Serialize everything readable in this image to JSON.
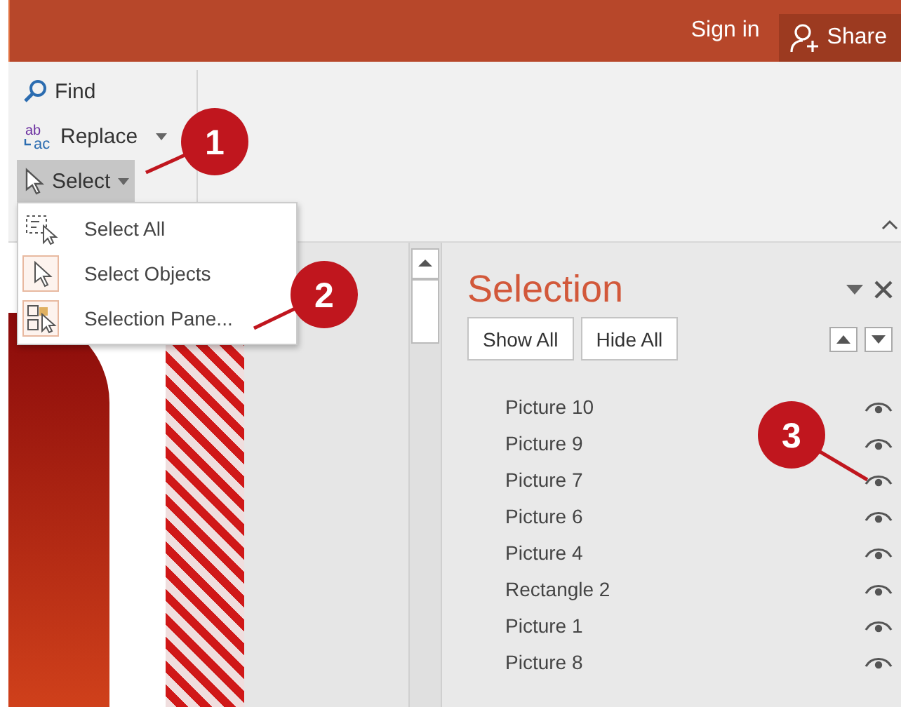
{
  "title_bar": {
    "sign_in": "Sign in",
    "share": "Share"
  },
  "ribbon": {
    "buttons": [
      {
        "kind": "find",
        "label": "Find",
        "dropdown": false,
        "pressed": false
      },
      {
        "kind": "replace",
        "label": "Replace",
        "dropdown": true,
        "pressed": false,
        "icon_text": [
          "ab",
          "ac"
        ]
      },
      {
        "kind": "select",
        "label": "Select",
        "dropdown": true,
        "pressed": true
      }
    ]
  },
  "select_menu": {
    "items": [
      {
        "kind": "select-all",
        "label": "Select All"
      },
      {
        "kind": "select-objects",
        "label": "Select Objects"
      },
      {
        "kind": "selection-pane",
        "label": "Selection Pane..."
      }
    ]
  },
  "selection_pane": {
    "title": "Selection",
    "buttons": [
      "Show All",
      "Hide All"
    ],
    "items": [
      {
        "name": "Picture 10",
        "visible": true
      },
      {
        "name": "Picture 9",
        "visible": true
      },
      {
        "name": "Picture 7",
        "visible": true
      },
      {
        "name": "Picture 6",
        "visible": true
      },
      {
        "name": "Picture 4",
        "visible": true
      },
      {
        "name": "Rectangle 2",
        "visible": true
      },
      {
        "name": "Picture 1",
        "visible": true
      },
      {
        "name": "Picture 8",
        "visible": true
      }
    ]
  },
  "callouts": [
    {
      "number": "1"
    },
    {
      "number": "2"
    },
    {
      "number": "3"
    }
  ]
}
